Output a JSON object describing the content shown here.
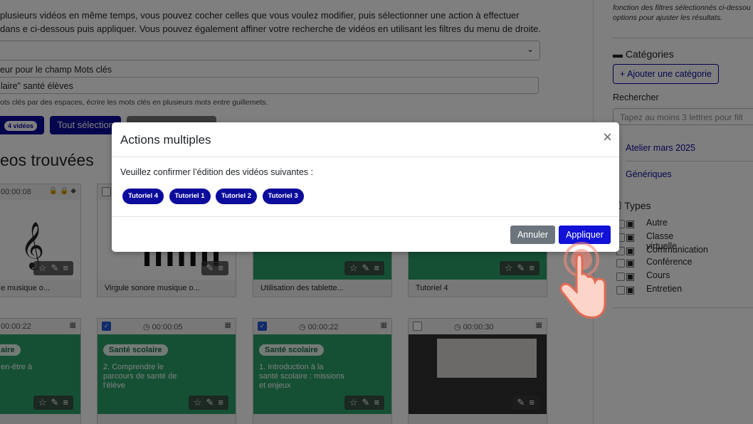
{
  "main": {
    "intro": "plusieurs vidéos en même temps, vous pouvez cocher celles que vous voulez modifier, puis sélectionner une action à effectuer dans e ci-dessous puis appliquer. Vous pouvez également affiner votre recherche de vidéos en utilisant les filtres du menu de droite.",
    "keywords_label": "eur pour le champ Mots clés",
    "keywords_value": "laire\" santé élèves",
    "keywords_help": "ots clés par des espaces, écrire les mots clés en plusieurs mots entre guillemets.",
    "count_badge": "4 vidéos",
    "select_all": "Tout sélection",
    "found_title": "eos trouvées"
  },
  "cards": [
    {
      "title": "e musique o...",
      "duration": "00:00:08",
      "checked": false
    },
    {
      "title": "Virgule sonore musique o...",
      "duration": "",
      "checked": false
    },
    {
      "title": "Utilisation des tablette...",
      "duration": "",
      "checked": false
    },
    {
      "title": "Tutoriel 4",
      "duration": "",
      "checked": false
    },
    {
      "title": "",
      "duration": "00:00:22",
      "checked": false,
      "tag": "aire",
      "text": "en-être à"
    },
    {
      "title": "",
      "duration": "00:00:05",
      "checked": true,
      "tag": "Santé scolaire",
      "text": "2. Comprendre le parcours de santé de l'élève"
    },
    {
      "title": "",
      "duration": "00:00:22",
      "checked": true,
      "tag": "Santé scolaire",
      "text": "1. Introduction à la santé scolaire : missions et enjeux"
    },
    {
      "title": "",
      "duration": "00:00:30",
      "checked": false
    }
  ],
  "modal": {
    "title": "Actions multiples",
    "close": "×",
    "body": "Veuillez confirmer l’édition des vidéos suivantes :",
    "chips": [
      "Tutoriel 4",
      "Tutoriel 1",
      "Tutoriel 2",
      "Tutoriel 3"
    ],
    "cancel": "Annuler",
    "apply": "Appliquer"
  },
  "sidebar": {
    "hint": "fonction des filtres sélectionnés ci-dessou options pour ajuster les résultats.",
    "categories_title": "Catégories",
    "add_category": "+ Ajouter une catégorie",
    "search_label": "Rechercher",
    "search_placeholder": "Tapez au moins 3 lettres pour filt",
    "categories": [
      "Atelier mars 2025",
      "Génériques"
    ],
    "types_title": "Types",
    "types": [
      "Autre",
      "Classe virtuelle",
      "Communication",
      "Conférence",
      "Cours",
      "Entretien"
    ]
  },
  "icons": {
    "chevron": "chevron-down-icon",
    "star": "star-icon",
    "edit": "edit-icon",
    "menu": "menu-icon",
    "clock": "clock-icon",
    "film": "film-icon"
  },
  "colors": {
    "primary": "#0b0b9c",
    "apply": "#1111d8",
    "cancel": "#6c757d",
    "green": "#2aa06a"
  }
}
